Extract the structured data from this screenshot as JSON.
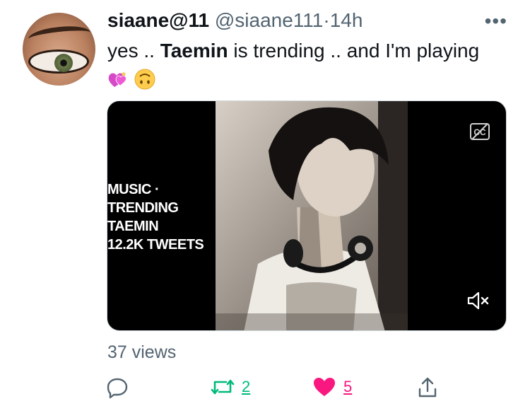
{
  "tweet": {
    "display_name": "siaane@11",
    "handle": "@siaane111",
    "separator": "·",
    "time": "14h",
    "more_label": "•••",
    "text_part1": "yes .. ",
    "text_bold": "Taemin",
    "text_part2": " is trending .. and I'm playing ",
    "heart_emoji": "💞",
    "face_emoji": "🙃"
  },
  "media": {
    "overlay_lines": [
      "MUSIC ·",
      "TRENDING",
      "TAEMIN",
      "12.2K TWEETS"
    ],
    "cc_icon": "cc-icon",
    "mute_icon": "mute-icon"
  },
  "stats": {
    "views": "37 views"
  },
  "actions": {
    "reply_icon": "reply-icon",
    "retweet_count": "2",
    "like_count": "5",
    "share_icon": "share-icon"
  },
  "colors": {
    "retweet": "#00ba7c",
    "like": "#f91880",
    "muted": "#536471"
  }
}
